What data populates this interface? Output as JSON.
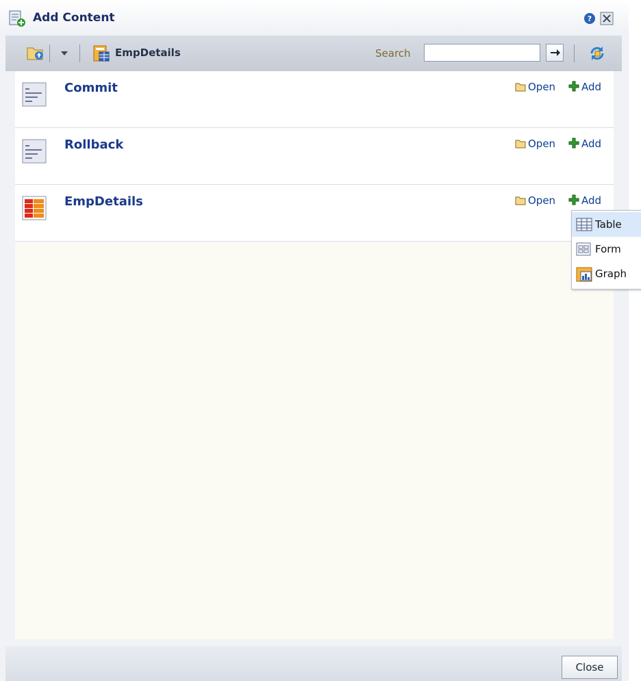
{
  "dialog": {
    "title": "Add Content",
    "icons": {
      "title": "add-content-icon",
      "help": "help-icon",
      "close": "close-icon"
    }
  },
  "toolbar": {
    "location_label": "EmpDetails",
    "search_label": "Search",
    "search_value": "",
    "icons": [
      "folder-up-icon",
      "dropdown-arrow-icon",
      "database-icon",
      "go-arrow-icon",
      "refresh-icon"
    ]
  },
  "items": [
    {
      "title": "Commit",
      "icon": "action-icon",
      "open_label": "Open",
      "add_label": "Add"
    },
    {
      "title": "Rollback",
      "icon": "action-icon",
      "open_label": "Open",
      "add_label": "Add"
    },
    {
      "title": "EmpDetails",
      "icon": "collection-icon",
      "open_label": "Open",
      "add_label": "Add"
    }
  ],
  "add_menu": {
    "items": [
      {
        "label": "Table",
        "icon": "table-icon",
        "selected": true
      },
      {
        "label": "Form",
        "icon": "form-icon",
        "selected": false
      },
      {
        "label": "Graph",
        "icon": "graph-icon",
        "selected": false
      }
    ]
  },
  "footer": {
    "close_label": "Close"
  },
  "colors": {
    "title": "#1b2f63",
    "link": "#0b3d91",
    "item_title": "#1a3a8c",
    "pane_bg": "#fbfbf3"
  }
}
